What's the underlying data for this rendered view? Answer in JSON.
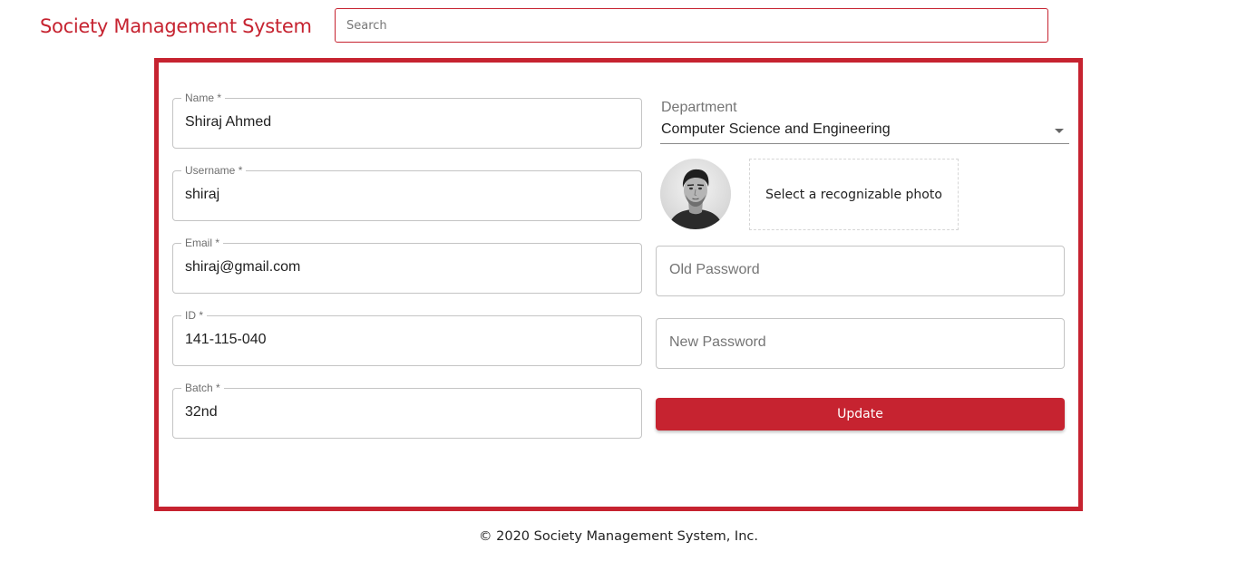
{
  "header": {
    "brand": "Society Management System",
    "search": {
      "placeholder": "Search",
      "value": ""
    }
  },
  "form": {
    "fields": {
      "name": {
        "label": "Name *",
        "value": "Shiraj Ahmed"
      },
      "username": {
        "label": "Username *",
        "value": "shiraj"
      },
      "email": {
        "label": "Email *",
        "value": "shiraj@gmail.com"
      },
      "id": {
        "label": "ID *",
        "value": "141-115-040"
      },
      "batch": {
        "label": "Batch *",
        "value": "32nd"
      }
    },
    "department": {
      "label": "Department",
      "value": "Computer Science and Engineering"
    },
    "photo": {
      "prompt": "Select a recognizable photo",
      "avatar_icon": "profile-photo"
    },
    "old_password": {
      "placeholder": "Old Password"
    },
    "new_password": {
      "placeholder": "New Password"
    },
    "update_label": "Update"
  },
  "footer": {
    "text": "© 2020 Society Management System, Inc."
  },
  "colors": {
    "accent": "#c62330",
    "border": "#c4c4c4",
    "text": "#212121",
    "muted": "#757575"
  }
}
